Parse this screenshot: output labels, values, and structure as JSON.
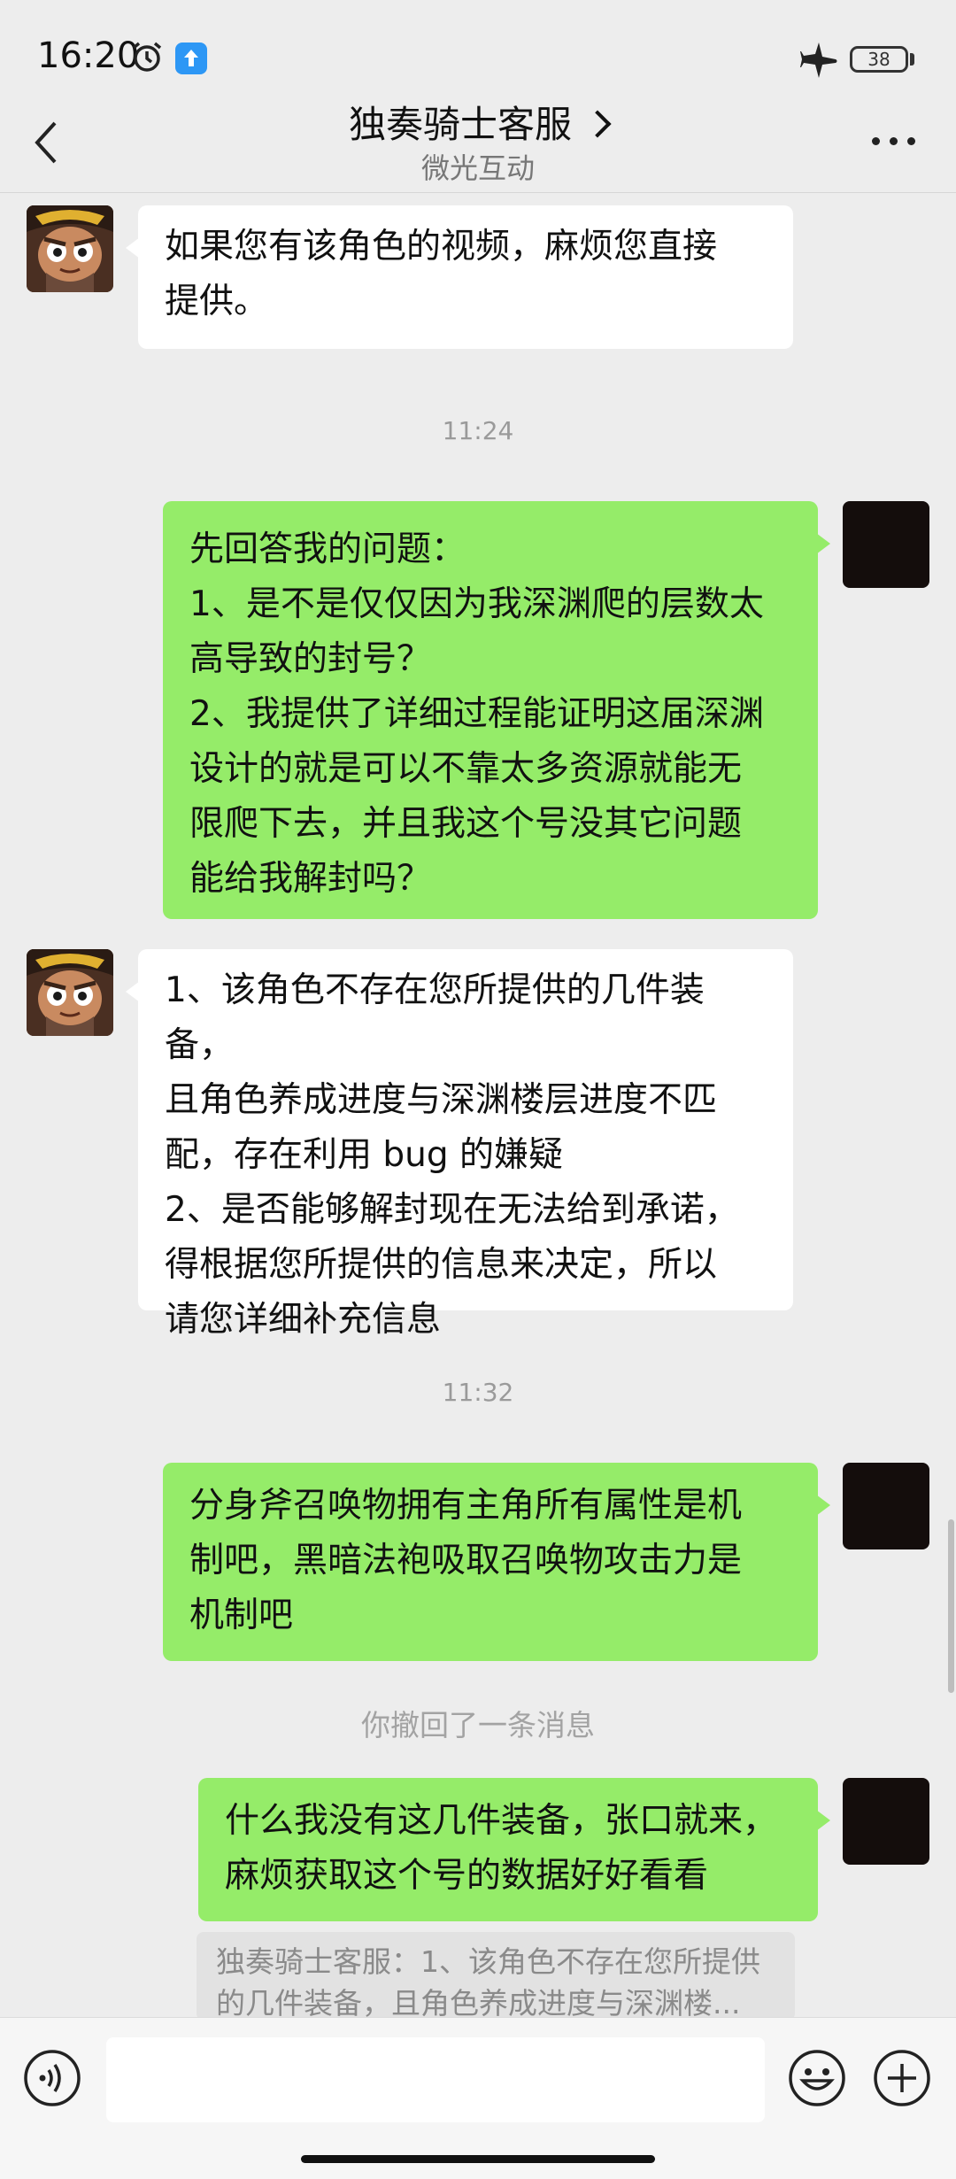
{
  "status_bar": {
    "time": "16:20",
    "battery": "38"
  },
  "header": {
    "title": "独奏骑士客服",
    "subtitle": "微光互动"
  },
  "messages": {
    "m1": "如果您有该角色的视频，麻烦您直接\n提供。",
    "t1": "11:24",
    "m2": "先回答我的问题：\n1、是不是仅仅因为我深渊爬的层数太\n高导致的封号？\n2、我提供了详细过程能证明这届深渊\n设计的就是可以不靠太多资源就能无\n限爬下去，并且我这个号没其它问题\n能给我解封吗？",
    "m3": "1、该角色不存在您所提供的几件装备，\n且角色养成进度与深渊楼层进度不匹\n配，存在利用 bug 的嫌疑\n2、是否能够解封现在无法给到承诺，\n得根据您所提供的信息来决定，所以\n请您详细补充信息",
    "t2": "11:32",
    "m4": "分身斧召唤物拥有主角所有属性是机\n制吧，黑暗法袍吸取召唤物攻击力是\n机制吧",
    "recall": "你撤回了一条消息",
    "m5": "什么我没有这几件装备，张口就来，\n麻烦获取这个号的数据好好看看",
    "quote": "独奏骑士客服：1、该角色不存在您所提供\n的几件装备，且角色养成进度与深渊楼..."
  },
  "input": {
    "value": ""
  },
  "colors": {
    "outgoing": "#95ec69",
    "incoming": "#ffffff",
    "background": "#ededed"
  }
}
